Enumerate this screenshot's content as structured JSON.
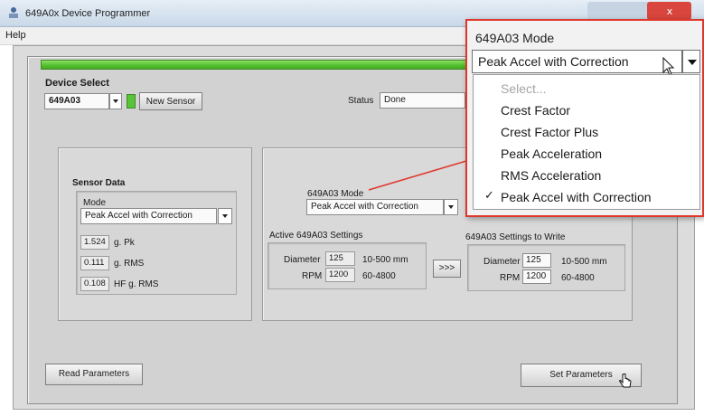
{
  "window": {
    "title": "649A0x Device Programmer"
  },
  "menu": {
    "help": "Help"
  },
  "device_select": {
    "label": "Device Select",
    "value": "649A03",
    "new_sensor_button": "New Sensor"
  },
  "status": {
    "label": "Status",
    "value": "Done"
  },
  "sensor_data": {
    "title": "Sensor Data",
    "mode_label": "Mode",
    "mode_value": "Peak Accel with Correction",
    "readings": [
      {
        "value": "1.524",
        "unit": "g. Pk"
      },
      {
        "value": "0.111",
        "unit": "g. RMS"
      },
      {
        "value": "0.108",
        "unit": "HF g. RMS"
      }
    ]
  },
  "mode_panel": {
    "label": "649A03 Mode",
    "value": "Peak Accel with Correction"
  },
  "active_settings": {
    "title": "Active 649A03 Settings",
    "diameter_label": "Diameter",
    "diameter_value": "125",
    "diameter_range": "10-500 mm",
    "rpm_label": "RPM",
    "rpm_value": "1200",
    "rpm_range": "60-4800"
  },
  "copy_button": ">>>",
  "write_settings": {
    "title": "649A03 Settings to Write",
    "diameter_label": "Diameter",
    "diameter_value": "125",
    "diameter_range": "10-500 mm",
    "rpm_label": "RPM",
    "rpm_value": "1200",
    "rpm_range": "60-4800"
  },
  "buttons": {
    "read": "Read Parameters",
    "set": "Set Parameters"
  },
  "callout": {
    "title": "649A03 Mode",
    "selected": "Peak Accel with Correction",
    "options": [
      "Select...",
      "Crest Factor",
      "Crest Factor Plus",
      "Peak Acceleration",
      "RMS Acceleration",
      "Peak Accel with Correction"
    ],
    "checked_index": 5
  },
  "colors": {
    "progress": "#4fbf2c",
    "callout_border": "#e0372c",
    "status_led": "#58c43a"
  }
}
